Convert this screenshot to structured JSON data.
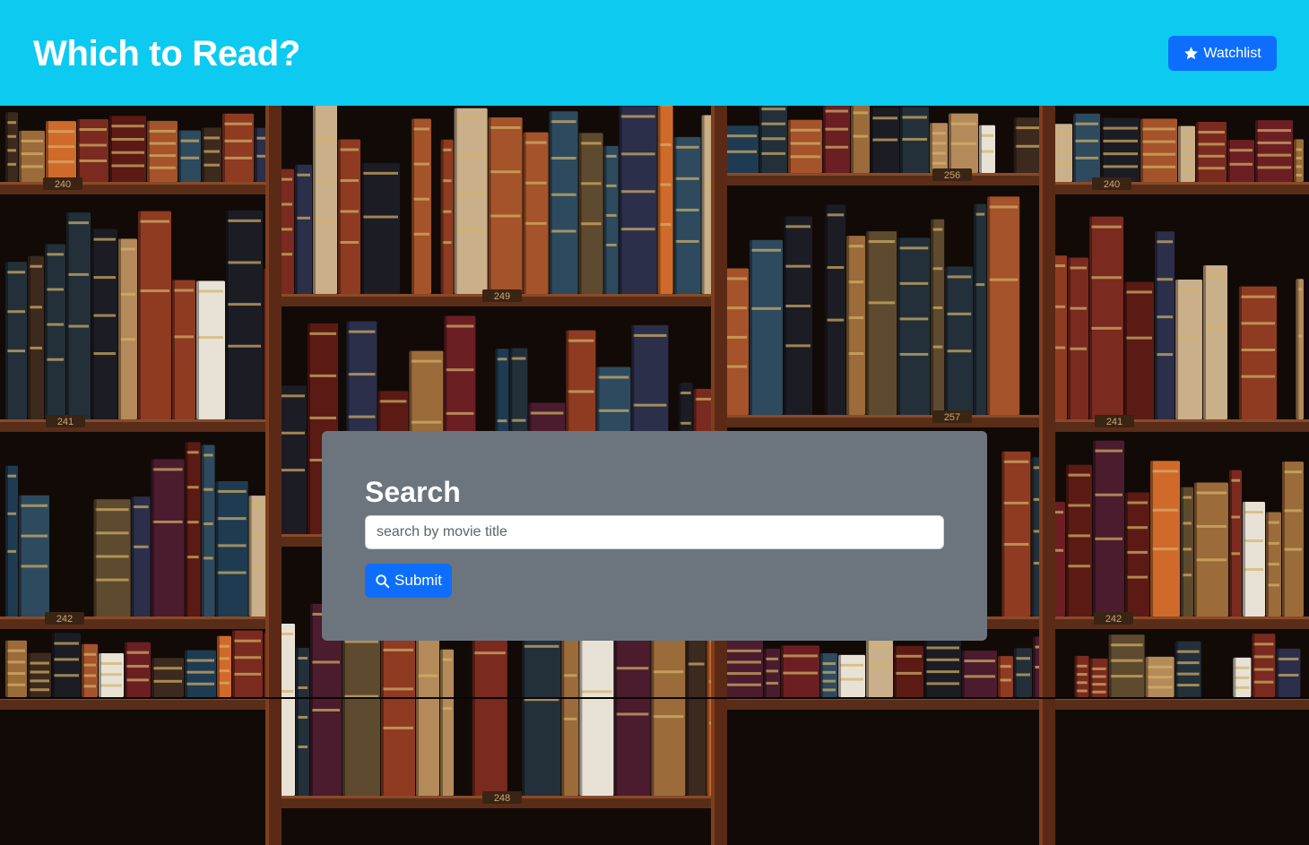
{
  "header": {
    "title": "Which to Read?",
    "watchlist_label": "Watchlist",
    "watchlist_icon": "star-icon"
  },
  "background": {
    "description_icon": "bookshelf-background",
    "shelf_numbers": [
      "240",
      "249",
      "256",
      "240",
      "241",
      "257",
      "241",
      "242",
      "242",
      "248"
    ]
  },
  "search": {
    "heading": "Search",
    "placeholder": "search by movie title",
    "value": "",
    "submit_label": "Submit",
    "submit_icon": "search-icon"
  },
  "colors": {
    "header_bg": "#0dcaf0",
    "primary": "#0d6efd",
    "card_bg": "#6c757d",
    "text_on_dark": "#ffffff"
  }
}
